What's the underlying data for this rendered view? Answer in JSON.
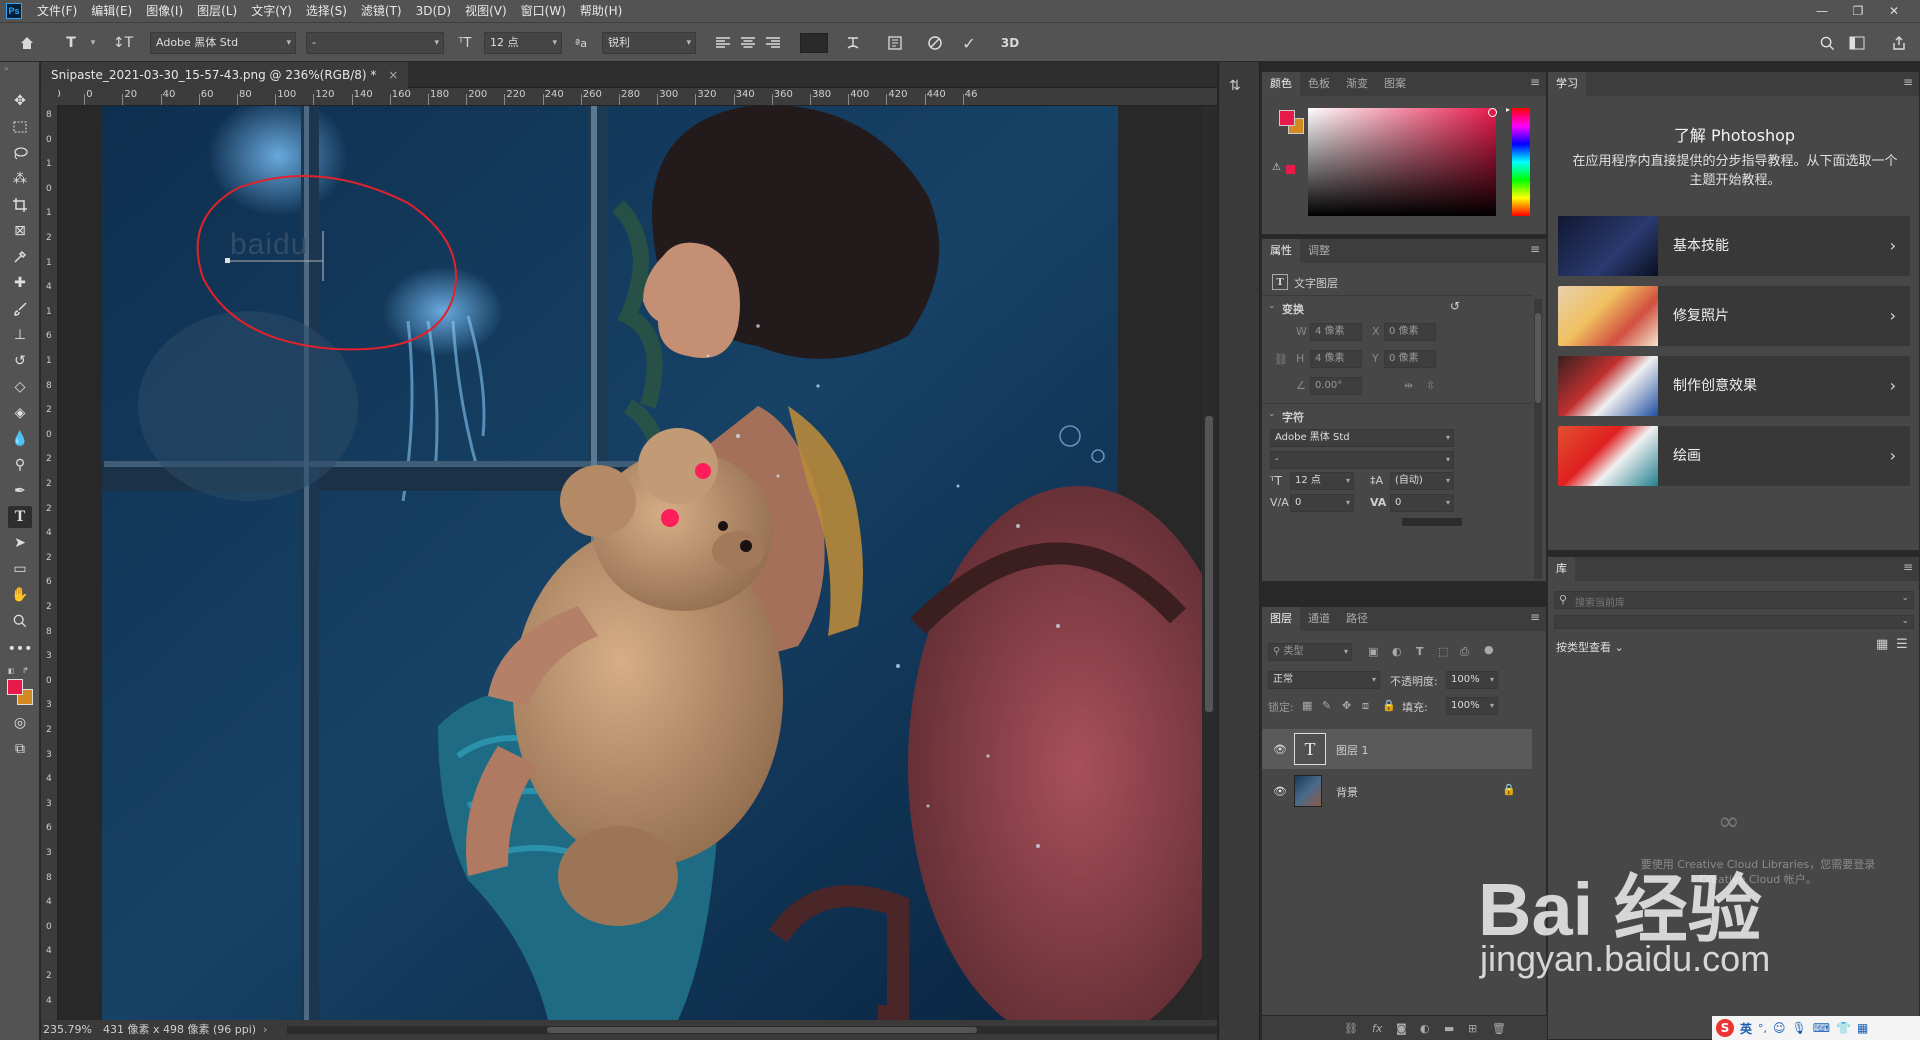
{
  "app": {
    "logo_text": "Ps",
    "menu": [
      "文件(F)",
      "编辑(E)",
      "图像(I)",
      "图层(L)",
      "文字(Y)",
      "选择(S)",
      "滤镜(T)",
      "3D(D)",
      "视图(V)",
      "窗口(W)",
      "帮助(H)"
    ]
  },
  "options_bar": {
    "font_family": "Adobe 黑体 Std",
    "font_style": "-",
    "font_size": "12 点",
    "aa_label": "ªa",
    "antialias": "锐利",
    "three_d": "3D"
  },
  "document": {
    "tab_title": "Snipaste_2021-03-30_15-57-43.png @ 236%(RGB/8) *",
    "ruler_h": [
      "20",
      "0",
      "20",
      "40",
      "60",
      "80",
      "100",
      "120",
      "140",
      "160",
      "180",
      "200",
      "220",
      "240",
      "260",
      "280",
      "300",
      "320",
      "340",
      "360",
      "380",
      "400",
      "420",
      "440",
      "46"
    ],
    "ruler_v": [
      "8",
      "0",
      "1",
      "0",
      "1",
      "2",
      "1",
      "4",
      "1",
      "6",
      "1",
      "8",
      "2",
      "0",
      "2",
      "2",
      "2",
      "4",
      "2",
      "6",
      "2",
      "8",
      "3",
      "0",
      "3",
      "2",
      "3",
      "4",
      "3",
      "6",
      "3",
      "8",
      "4",
      "0",
      "4",
      "2",
      "4",
      "4"
    ],
    "typed_text": "baidu",
    "status_zoom": "235.79%",
    "status_info": "431 像素 x 498 像素 (96 ppi)"
  },
  "color_panel": {
    "tabs": [
      "颜色",
      "色板",
      "渐变",
      "图案"
    ],
    "foreground": "#e8194b",
    "background": "#d48a22"
  },
  "properties_panel": {
    "tabs": [
      "属性",
      "调整"
    ],
    "layer_type": "文字图层",
    "transform_header": "变换",
    "w_label": "W",
    "w_value": "4 像素",
    "h_label": "H",
    "h_value": "4 像素",
    "x_label": "X",
    "x_value": "0 像素",
    "y_label": "Y",
    "y_value": "0 像素",
    "angle": "0.00°",
    "char_header": "字符",
    "font_family": "Adobe 黑体 Std",
    "font_style": "-",
    "font_size": "12 点",
    "leading": "(自动)",
    "kerning": "0",
    "tracking": "0"
  },
  "layers_panel": {
    "tabs": [
      "图层",
      "通道",
      "路径"
    ],
    "filter_placeholder": "类型",
    "blend_mode": "正常",
    "opacity_label": "不透明度:",
    "opacity_value": "100%",
    "lock_label": "锁定:",
    "fill_label": "填充:",
    "fill_value": "100%",
    "layers": [
      {
        "name": "图层 1",
        "kind": "text",
        "selected": true
      },
      {
        "name": "背景",
        "kind": "image",
        "locked": true
      }
    ]
  },
  "learn_panel": {
    "tab": "学习",
    "title": "了解 Photoshop",
    "description": "在应用程序内直接提供的分步指导教程。从下面选取一个主题开始教程。",
    "cards": [
      {
        "title": "基本技能"
      },
      {
        "title": "修复照片"
      },
      {
        "title": "制作创意效果"
      },
      {
        "title": "绘画"
      }
    ]
  },
  "library_panel": {
    "tab": "库",
    "search_placeholder": "搜索当前库",
    "view_by": "按类型查看",
    "cc_message": "要使用 Creative Cloud Libraries，您需要登录 Creative Cloud 帐户。"
  },
  "watermark": {
    "text": "Bai 经验",
    "url": "jingyan.baidu.com"
  },
  "ime": {
    "badge": "S",
    "lang": "英"
  }
}
